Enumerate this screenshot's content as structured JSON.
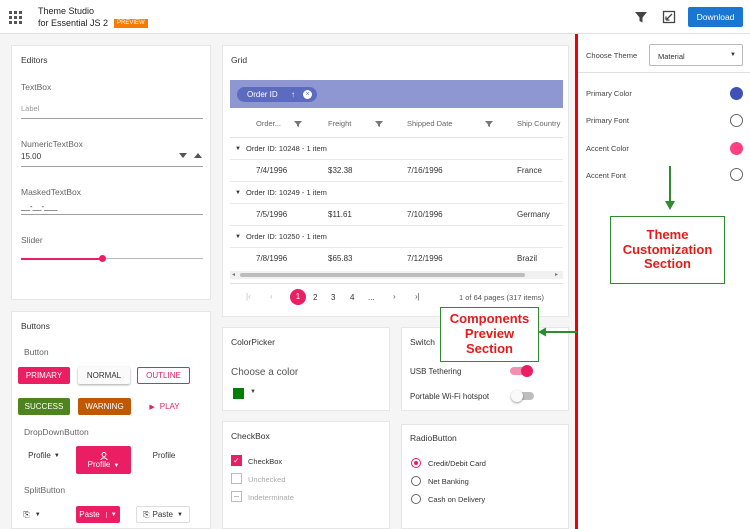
{
  "header": {
    "title_line1": "Theme Studio",
    "title_line2": "for Essential JS 2",
    "badge": "PREVIEW",
    "download": "Download"
  },
  "editors": {
    "title": "Editors",
    "textbox": "TextBox",
    "textbox_placeholder": "Label",
    "numeric": "NumericTextBox",
    "numeric_value": "15.00",
    "masked": "MaskedTextBox",
    "masked_value": "__-__-___",
    "slider": "Slider",
    "slider_value": 0.45
  },
  "buttons": {
    "title": "Buttons",
    "button_label": "Button",
    "primary": "PRIMARY",
    "normal": "NORMAL",
    "outline": "OUTLINE",
    "success": "SUCCESS",
    "warning": "WARNING",
    "play": "PLAY",
    "dropdown": "DropDownButton",
    "profile": "Profile",
    "split": "SplitButton",
    "paste": "Paste"
  },
  "grid": {
    "title": "Grid",
    "group_chip": "Order ID",
    "columns": [
      "Order...",
      "Freight",
      "Shipped Date",
      "Ship Country"
    ],
    "groups": [
      {
        "header": "Order ID: 10248 - 1 item",
        "row": [
          "7/4/1996",
          "$32.38",
          "7/16/1996",
          "France"
        ]
      },
      {
        "header": "Order ID: 10249 - 1 item",
        "row": [
          "7/5/1996",
          "$11.61",
          "7/10/1996",
          "Germany"
        ]
      },
      {
        "header": "Order ID: 10250 - 1 item",
        "row": [
          "7/8/1996",
          "$65.83",
          "7/12/1996",
          "Brazil"
        ]
      }
    ],
    "pages": [
      "1",
      "2",
      "3",
      "4",
      "..."
    ],
    "pager_info": "1 of 64 pages (317 items)"
  },
  "colorpicker": {
    "title": "ColorPicker",
    "prompt": "Choose a color",
    "color": "#008000"
  },
  "switch": {
    "title": "Switch",
    "item1": "USB Tethering",
    "item2": "Portable Wi-Fi hotspot"
  },
  "checkbox": {
    "title": "CheckBox",
    "item1": "CheckBox",
    "item2": "Unchecked",
    "item3": "Indeterminate"
  },
  "radio": {
    "title": "RadioButton",
    "item1": "Credit/Debit Card",
    "item2": "Net Banking",
    "item3": "Cash on Delivery"
  },
  "panel": {
    "choose_theme": "Choose Theme",
    "theme": "Material",
    "primary_color": "Primary Color",
    "primary_color_value": "#3f51b5",
    "primary_font": "Primary Font",
    "accent_color": "Accent Color",
    "accent_color_value": "#ff4081",
    "accent_font": "Accent Font"
  },
  "annotations": {
    "preview": "Components Preview Section",
    "custom": "Theme Customization Section"
  },
  "colors": {
    "accent": "#e91e63",
    "primary": "#3f51b5",
    "success": "#4d841d",
    "warning": "#c15700",
    "annot_text": "#e31b1b",
    "annot_border": "#2e8b2e"
  }
}
